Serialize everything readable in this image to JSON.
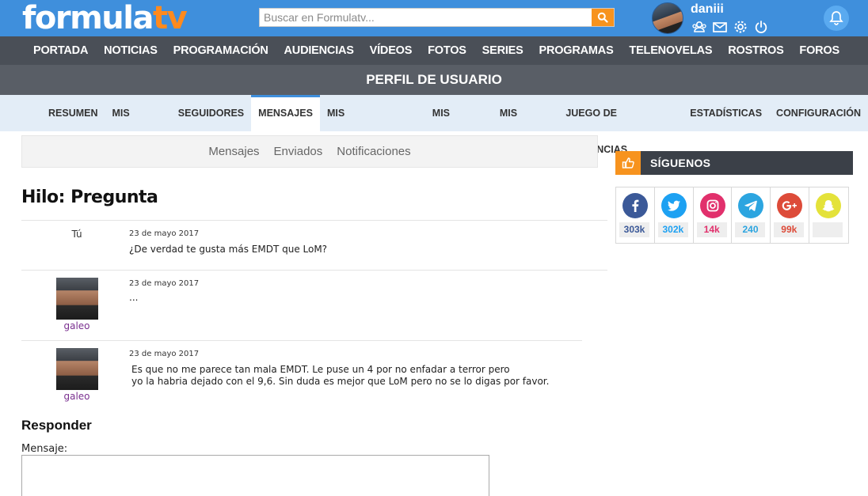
{
  "header": {
    "logo_main": "formula",
    "logo_accent": "tv",
    "search_placeholder": "Buscar en Formulatv...",
    "user_name": "daniii"
  },
  "main_nav": [
    "PORTADA",
    "NOTICIAS",
    "PROGRAMACIÓN",
    "AUDIENCIAS",
    "VÍDEOS",
    "FOTOS",
    "SERIES",
    "PROGRAMAS",
    "TELENOVELAS",
    "ROSTROS",
    "FOROS"
  ],
  "profile_bar": {
    "title": "PERFIL DE USUARIO"
  },
  "sub_nav": {
    "items": [
      "RESUMEN",
      "MIS DATOS",
      "SEGUIDORES",
      "MENSAJES",
      "MIS COMUNIDADES",
      "MIS BLOGS",
      "MIS FOTOS",
      "JUEGO DE AUDIENCIAS",
      "ESTADÍSTICAS",
      "CONFIGURACIÓN"
    ],
    "active": "MENSAJES"
  },
  "message_tabs": [
    "Mensajes",
    "Enviados",
    "Notificaciones"
  ],
  "thread": {
    "title": "Hilo: Pregunta",
    "messages": [
      {
        "author": "Tú",
        "date": "23 de mayo 2017",
        "body": [
          "¿De verdad te gusta más EMDT que LoM?"
        ]
      },
      {
        "author": "galeo",
        "date": "23 de mayo 2017",
        "body": [
          "..."
        ]
      },
      {
        "author": "galeo",
        "date": "23 de mayo 2017",
        "body": [
          "Es que no me parece tan mala EMDT. Le puse un 4 por no enfadar a terror pero",
          "yo la habria dejado con el 9,6. Sin duda es mejor que LoM pero no se lo digas por favor."
        ]
      }
    ]
  },
  "reply": {
    "title": "Responder",
    "label": "Mensaje:"
  },
  "sidebar": {
    "follow_title": "SÍGUENOS",
    "social": [
      {
        "icon": "facebook-icon",
        "count": "303k",
        "color": "#3b5998"
      },
      {
        "icon": "twitter-icon",
        "count": "302k",
        "color": "#1da1f2"
      },
      {
        "icon": "instagram-icon",
        "count": "14k",
        "color": "#e1306c"
      },
      {
        "icon": "telegram-icon",
        "count": "240",
        "color": "#2ca5e0"
      },
      {
        "icon": "google-plus-icon",
        "count": "99k",
        "color": "#dd4b39"
      },
      {
        "icon": "snapchat-icon",
        "count": "",
        "color": "#e4e23a"
      }
    ]
  },
  "colors": {
    "brand_blue": "#3f8fdc",
    "brand_orange": "#f7931e",
    "nav_dark": "#4a4f57"
  }
}
